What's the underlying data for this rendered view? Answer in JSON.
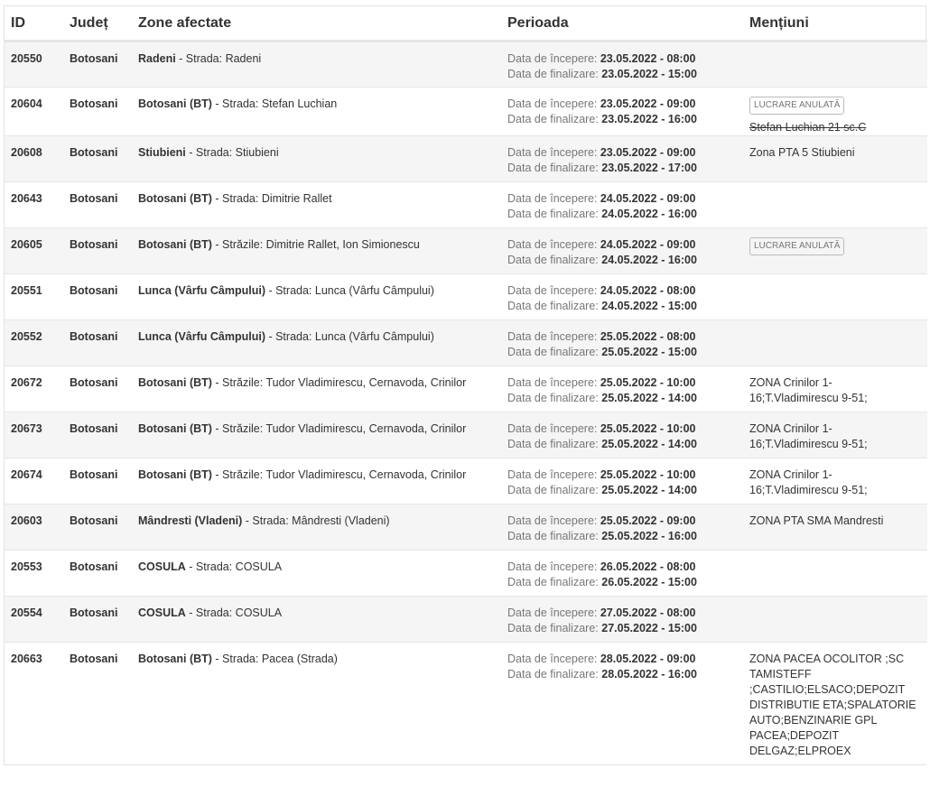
{
  "headers": {
    "id": "ID",
    "judet": "Județ",
    "zone": "Zone afectate",
    "perioada": "Perioada",
    "mentiuni": "Mențiuni"
  },
  "labels": {
    "start": "Data de începere:",
    "end": "Data de finalizare:"
  },
  "rows": [
    {
      "id": "20550",
      "judet": "Botosani",
      "zone_bold": "Radeni",
      "zone_rest": " - Strada: Radeni",
      "start": "23.05.2022 - 08:00",
      "end": "23.05.2022 - 15:00",
      "badge": "",
      "strike": "",
      "mentiuni": ""
    },
    {
      "id": "20604",
      "judet": "Botosani",
      "zone_bold": "Botosani (BT)",
      "zone_rest": " - Strada: Stefan Luchian",
      "start": "23.05.2022 - 09:00",
      "end": "23.05.2022 - 16:00",
      "badge": "LUCRARE ANULATĂ",
      "strike": "Stefan Luchian 21 sc.C",
      "mentiuni": ""
    },
    {
      "id": "20608",
      "judet": "Botosani",
      "zone_bold": "Stiubieni",
      "zone_rest": " - Strada: Stiubieni",
      "start": "23.05.2022 - 09:00",
      "end": "23.05.2022 - 17:00",
      "badge": "",
      "strike": "",
      "mentiuni": "Zona PTA 5 Stiubieni"
    },
    {
      "id": "20643",
      "judet": "Botosani",
      "zone_bold": "Botosani (BT)",
      "zone_rest": " - Strada: Dimitrie Rallet",
      "start": "24.05.2022 - 09:00",
      "end": "24.05.2022 - 16:00",
      "badge": "",
      "strike": "",
      "mentiuni": ""
    },
    {
      "id": "20605",
      "judet": "Botosani",
      "zone_bold": "Botosani (BT)",
      "zone_rest": " - Străzile: Dimitrie Rallet, Ion Simionescu",
      "start": "24.05.2022 - 09:00",
      "end": "24.05.2022 - 16:00",
      "badge": "LUCRARE ANULATĂ",
      "strike": "",
      "mentiuni": ""
    },
    {
      "id": "20551",
      "judet": "Botosani",
      "zone_bold": "Lunca (Vârfu Câmpului)",
      "zone_rest": " - Strada: Lunca (Vârfu Câmpului)",
      "start": "24.05.2022 - 08:00",
      "end": "24.05.2022 - 15:00",
      "badge": "",
      "strike": "",
      "mentiuni": ""
    },
    {
      "id": "20552",
      "judet": "Botosani",
      "zone_bold": "Lunca (Vârfu Câmpului)",
      "zone_rest": " - Strada: Lunca (Vârfu Câmpului)",
      "start": "25.05.2022 - 08:00",
      "end": "25.05.2022 - 15:00",
      "badge": "",
      "strike": "",
      "mentiuni": ""
    },
    {
      "id": "20672",
      "judet": "Botosani",
      "zone_bold": "Botosani (BT)",
      "zone_rest": " - Străzile: Tudor Vladimirescu, Cernavoda, Crinilor",
      "start": "25.05.2022 - 10:00",
      "end": "25.05.2022 - 14:00",
      "badge": "",
      "strike": "",
      "mentiuni": "ZONA Crinilor 1-\n16;T.Vladimirescu 9-51;"
    },
    {
      "id": "20673",
      "judet": "Botosani",
      "zone_bold": "Botosani (BT)",
      "zone_rest": " - Străzile: Tudor Vladimirescu, Cernavoda, Crinilor",
      "start": "25.05.2022 - 10:00",
      "end": "25.05.2022 - 14:00",
      "badge": "",
      "strike": "",
      "mentiuni": "ZONA Crinilor 1-\n16;T.Vladimirescu 9-51;"
    },
    {
      "id": "20674",
      "judet": "Botosani",
      "zone_bold": "Botosani (BT)",
      "zone_rest": " - Străzile: Tudor Vladimirescu, Cernavoda, Crinilor",
      "start": "25.05.2022 - 10:00",
      "end": "25.05.2022 - 14:00",
      "badge": "",
      "strike": "",
      "mentiuni": "ZONA Crinilor 1-\n16;T.Vladimirescu 9-51;"
    },
    {
      "id": "20603",
      "judet": "Botosani",
      "zone_bold": "Mândresti (Vladeni)",
      "zone_rest": " - Strada: Mândresti (Vladeni)",
      "start": "25.05.2022 - 09:00",
      "end": "25.05.2022 - 16:00",
      "badge": "",
      "strike": "",
      "mentiuni": "ZONA PTA SMA Mandresti"
    },
    {
      "id": "20553",
      "judet": "Botosani",
      "zone_bold": "COSULA",
      "zone_rest": " - Strada: COSULA",
      "start": "26.05.2022 - 08:00",
      "end": "26.05.2022 - 15:00",
      "badge": "",
      "strike": "",
      "mentiuni": ""
    },
    {
      "id": "20554",
      "judet": "Botosani",
      "zone_bold": "COSULA",
      "zone_rest": " - Strada: COSULA",
      "start": "27.05.2022 - 08:00",
      "end": "27.05.2022 - 15:00",
      "badge": "",
      "strike": "",
      "mentiuni": ""
    },
    {
      "id": "20663",
      "judet": "Botosani",
      "zone_bold": "Botosani (BT)",
      "zone_rest": " - Strada: Pacea (Strada)",
      "start": "28.05.2022 - 09:00",
      "end": "28.05.2022 - 16:00",
      "badge": "",
      "strike": "",
      "mentiuni": "ZONA PACEA OCOLITOR ;SC\nTAMISTEFF\n;CASTILIO;ELSACO;DEPOZIT\nDISTRIBUTIE ETA;SPALATORIE\nAUTO;BENZINARIE GPL\nPACEA;DEPOZIT\nDELGAZ;ELPROEX"
    }
  ]
}
